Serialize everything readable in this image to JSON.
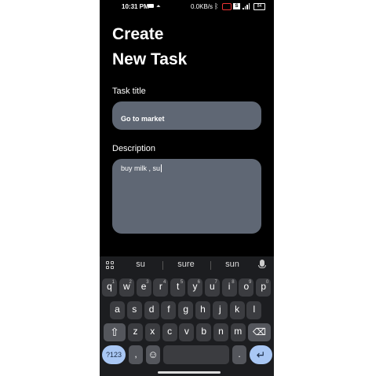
{
  "status_bar": {
    "time": "10:31 PM",
    "network_speed": "0.0KB/s",
    "sim_label": "Ѕ",
    "battery": "84"
  },
  "page": {
    "title_line1": "Create",
    "title_line2": "New Task"
  },
  "form": {
    "task_title_label": "Task title",
    "task_title_value": "Go to market",
    "description_label": "Description",
    "description_value": "buy milk , su"
  },
  "keyboard": {
    "suggestions": [
      "su",
      "sure",
      "sun"
    ],
    "row1": [
      {
        "k": "q",
        "n": "1"
      },
      {
        "k": "w",
        "n": "2"
      },
      {
        "k": "e",
        "n": "3"
      },
      {
        "k": "r",
        "n": "4"
      },
      {
        "k": "t",
        "n": "5"
      },
      {
        "k": "y",
        "n": "6"
      },
      {
        "k": "u",
        "n": "7"
      },
      {
        "k": "i",
        "n": "8"
      },
      {
        "k": "o",
        "n": "9"
      },
      {
        "k": "p",
        "n": "0"
      }
    ],
    "row2": [
      "a",
      "s",
      "d",
      "f",
      "g",
      "h",
      "j",
      "k",
      "l"
    ],
    "row3": [
      "z",
      "x",
      "c",
      "v",
      "b",
      "n",
      "m"
    ],
    "shift_glyph": "⇧",
    "backspace_glyph": "⌫",
    "symbols_label": "?123",
    "comma": ",",
    "emoji_glyph": "☺",
    "period": ".",
    "enter_glyph": "↵"
  },
  "colors": {
    "background": "#000000",
    "field_fill": "#5f6774",
    "keyboard_bg": "#1c1d20",
    "key_fill": "#3b3c40",
    "accent_key": "#a9c7f4"
  }
}
